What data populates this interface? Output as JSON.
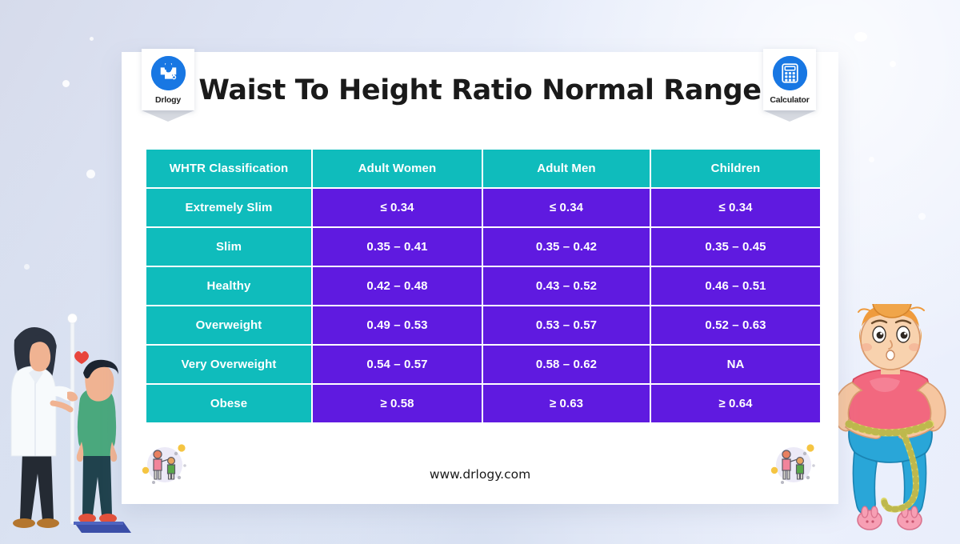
{
  "page": {
    "background_top_left": "#d6dbeb",
    "background_top_right": "#eef2fd"
  },
  "header": {
    "title": "Waist To Height Ratio Normal Range",
    "brand_badge": {
      "label": "Drlogy",
      "icon": "medical-cross-stethoscope-icon",
      "circle_color": "#1877e3"
    },
    "tool_badge": {
      "label": "Calculator",
      "icon": "calculator-icon",
      "circle_color": "#1877e3"
    }
  },
  "table": {
    "header_color": "#0fbcbc",
    "cell_color": "#5f1ae0",
    "columns": [
      "WHTR Classification",
      "Adult Women",
      "Adult Men",
      "Children"
    ],
    "rows": [
      {
        "classification": "Extremely Slim",
        "adult_women": "≤ 0.34",
        "adult_men": "≤ 0.34",
        "children": "≤ 0.34"
      },
      {
        "classification": "Slim",
        "adult_women": "0.35 – 0.41",
        "adult_men": "0.35 – 0.42",
        "children": "0.35 – 0.45"
      },
      {
        "classification": "Healthy",
        "adult_women": "0.42 – 0.48",
        "adult_men": "0.43 – 0.52",
        "children": "0.46 – 0.51"
      },
      {
        "classification": "Overweight",
        "adult_women": "0.49 – 0.53",
        "adult_men": "0.53 – 0.57",
        "children": "0.52 – 0.63"
      },
      {
        "classification": "Very Overweight",
        "adult_women": "0.54 – 0.57",
        "adult_men": "0.58 – 0.62",
        "children": "NA"
      },
      {
        "classification": "Obese",
        "adult_women": "≥ 0.58",
        "adult_men": "≥ 0.63",
        "children": "≥ 0.64"
      }
    ]
  },
  "footer": {
    "url": "www.drlogy.com",
    "left_icon": "height-measurement-icon",
    "right_icon": "height-measurement-icon"
  },
  "illustrations": {
    "left": "doctor-measuring-child-height-illustration",
    "right": "woman-measuring-waist-with-tape-illustration"
  }
}
